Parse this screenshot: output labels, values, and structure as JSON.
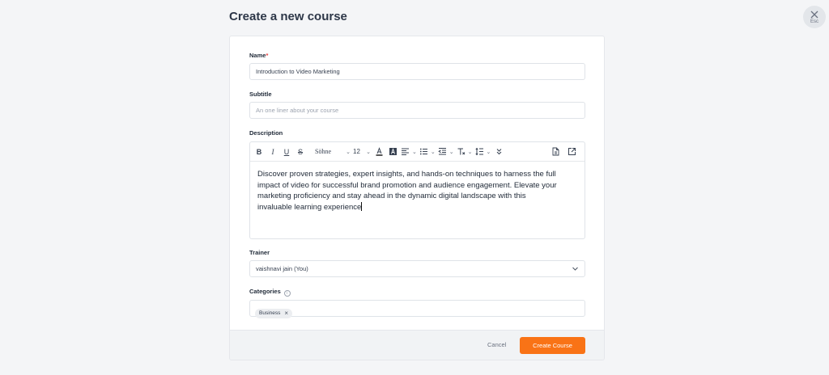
{
  "page": {
    "title": "Create a new course"
  },
  "esc": {
    "label": "Esc",
    "icon": "close-icon"
  },
  "form": {
    "name_label": "Name",
    "name_required": "*",
    "name_value": "Introduction to Video Marketing",
    "subtitle_label": "Subtitle",
    "subtitle_placeholder": "An one liner about your course",
    "description_label": "Description",
    "description_text": "Discover proven strategies, expert insights, and hands-on techniques to harness the full impact of video for successful brand promotion and audience engagement. Elevate your marketing proficiency and stay ahead in the dynamic digital landscape with this invaluable learning experience",
    "trainer_label": "Trainer",
    "trainer_value": "vaishnavi jain (You)",
    "categories_label": "Categories",
    "categories": [
      {
        "label": "Business"
      }
    ]
  },
  "toolbar": {
    "bold": "B",
    "italic": "I",
    "underline": "U",
    "strike": "S",
    "font": "Söhne",
    "size": "12"
  },
  "footer": {
    "cancel": "Cancel",
    "create": "Create Course"
  },
  "colors": {
    "accent": "#f97316",
    "required": "#e53e3e"
  }
}
